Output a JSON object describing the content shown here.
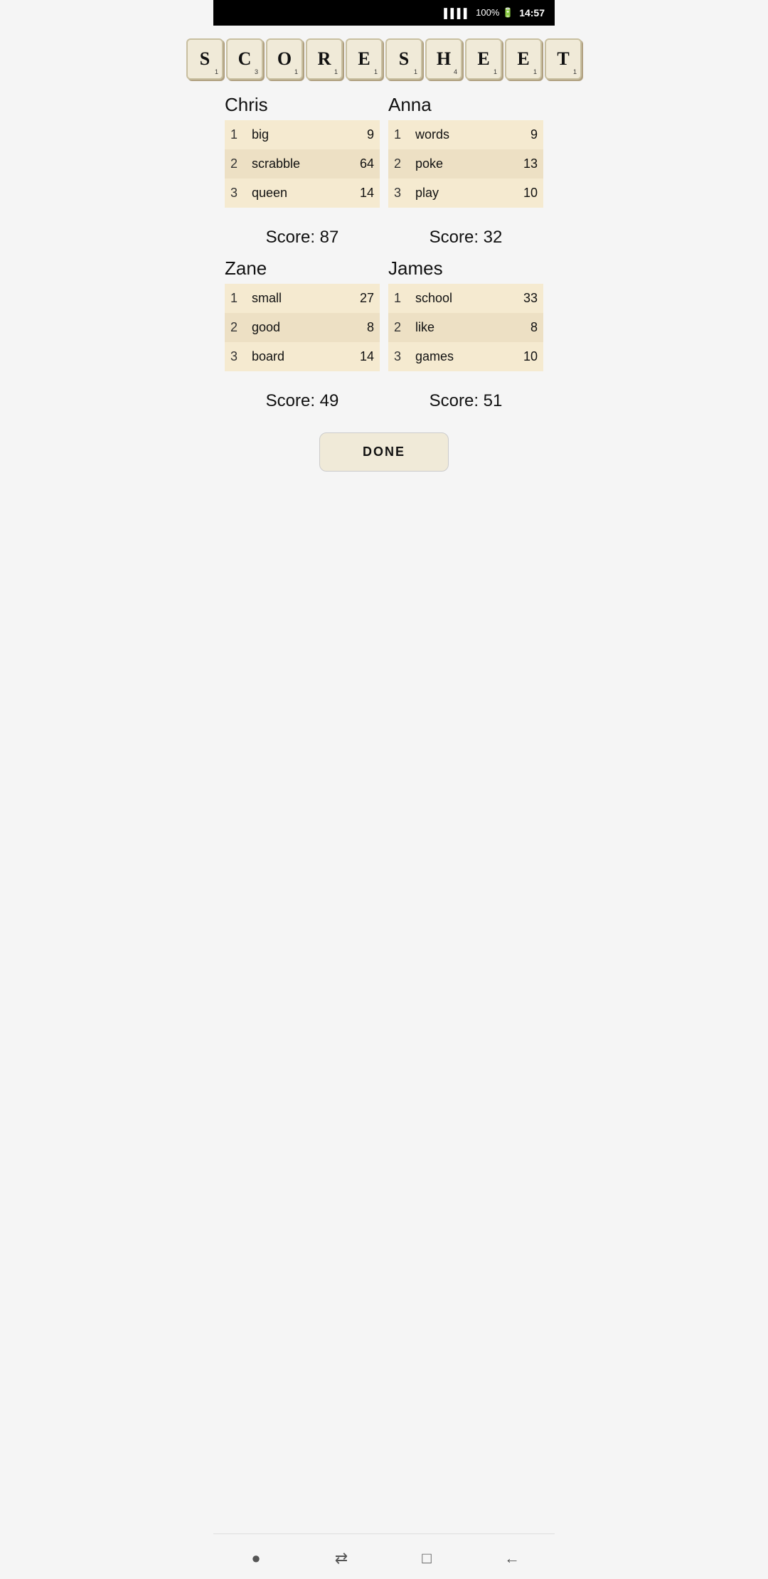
{
  "statusBar": {
    "signal": "▌▌▌▌",
    "battery": "100% 🔋",
    "time": "14:57"
  },
  "title": {
    "letters": [
      {
        "char": "S",
        "points": "1"
      },
      {
        "char": "C",
        "points": "3"
      },
      {
        "char": "O",
        "points": "1"
      },
      {
        "char": "R",
        "points": "1"
      },
      {
        "char": "E",
        "points": "1"
      },
      {
        "char": "S",
        "points": "1"
      },
      {
        "char": "H",
        "points": "4"
      },
      {
        "char": "E",
        "points": "1"
      },
      {
        "char": "E",
        "points": "1"
      },
      {
        "char": "T",
        "points": "1"
      }
    ]
  },
  "players": [
    {
      "name": "Chris",
      "plays": [
        {
          "num": 1,
          "word": "big",
          "score": 9
        },
        {
          "num": 2,
          "word": "scrabble",
          "score": 64
        },
        {
          "num": 3,
          "word": "queen",
          "score": 14
        }
      ],
      "total": "Score: 87"
    },
    {
      "name": "Anna",
      "plays": [
        {
          "num": 1,
          "word": "words",
          "score": 9
        },
        {
          "num": 2,
          "word": "poke",
          "score": 13
        },
        {
          "num": 3,
          "word": "play",
          "score": 10
        }
      ],
      "total": "Score: 32"
    },
    {
      "name": "Zane",
      "plays": [
        {
          "num": 1,
          "word": "small",
          "score": 27
        },
        {
          "num": 2,
          "word": "good",
          "score": 8
        },
        {
          "num": 3,
          "word": "board",
          "score": 14
        }
      ],
      "total": "Score: 49"
    },
    {
      "name": "James",
      "plays": [
        {
          "num": 1,
          "word": "school",
          "score": 33
        },
        {
          "num": 2,
          "word": "like",
          "score": 8
        },
        {
          "num": 3,
          "word": "games",
          "score": 10
        }
      ],
      "total": "Score: 51"
    }
  ],
  "doneButton": "DONE",
  "nav": {
    "dot": "●",
    "transfer": "⇄",
    "square": "□",
    "back": "←"
  }
}
